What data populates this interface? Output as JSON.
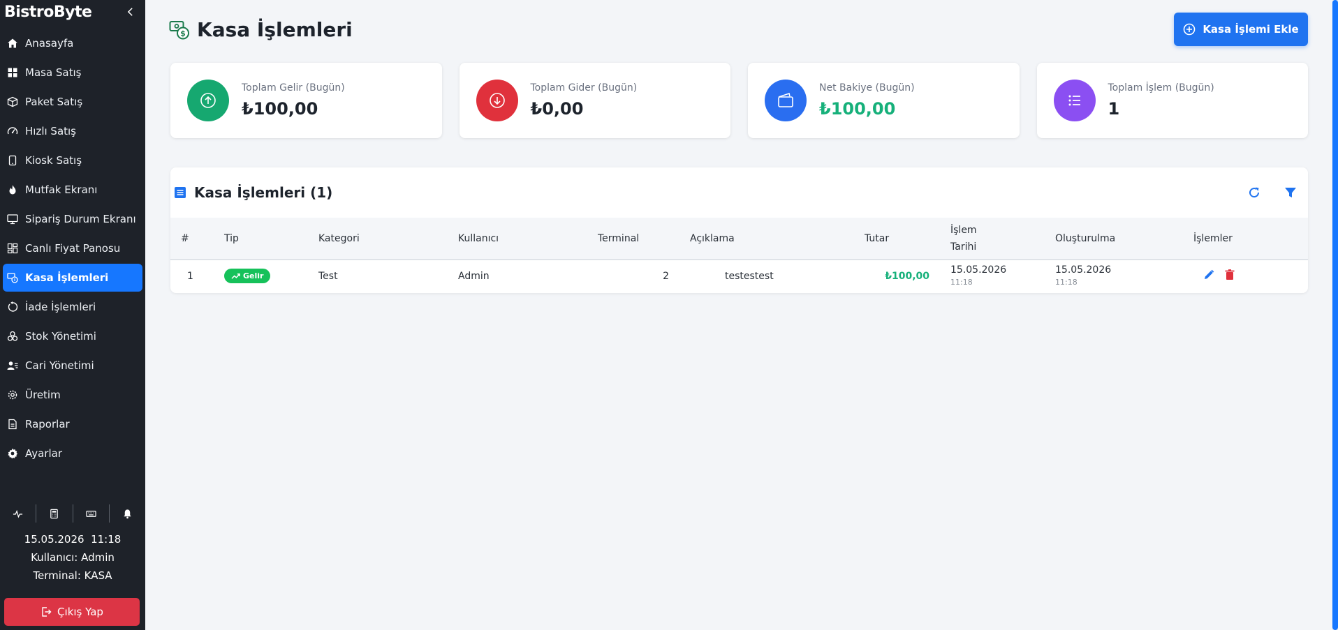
{
  "app": {
    "brand": "BistroByte"
  },
  "sidebar": {
    "items": [
      {
        "label": "Anasayfa",
        "icon": "home-icon"
      },
      {
        "label": "Masa Satış",
        "icon": "grid-icon"
      },
      {
        "label": "Paket Satış",
        "icon": "box-icon"
      },
      {
        "label": "Hızlı Satış",
        "icon": "speedometer-icon"
      },
      {
        "label": "Kiosk Satış",
        "icon": "tablet-icon"
      },
      {
        "label": "Mutfak Ekranı",
        "icon": "fire-icon"
      },
      {
        "label": "Sipariş Durum Ekranı",
        "icon": "monitor-icon"
      },
      {
        "label": "Canlı Fiyat Panosu",
        "icon": "dashboard-icon"
      },
      {
        "label": "Kasa İşlemleri",
        "icon": "cash-icon",
        "active": true
      },
      {
        "label": "İade İşlemleri",
        "icon": "refund-icon"
      },
      {
        "label": "Stok Yönetimi",
        "icon": "boxes-icon"
      },
      {
        "label": "Cari Yönetimi",
        "icon": "user-card-icon"
      },
      {
        "label": "Üretim",
        "icon": "gear-icon"
      },
      {
        "label": "Raporlar",
        "icon": "report-icon"
      },
      {
        "label": "Ayarlar",
        "icon": "settings-icon"
      }
    ],
    "datetime": "15.05.2026  11:18",
    "user": "Kullanıcı: Admin",
    "terminal": "Terminal: KASA",
    "logout_label": "Çıkış Yap"
  },
  "page": {
    "title": "Kasa İşlemleri",
    "add_button": "Kasa İşlemi Ekle"
  },
  "stats": [
    {
      "label": "Toplam Gelir (Bugün)",
      "value": "₺100,00",
      "color": "#16a870"
    },
    {
      "label": "Toplam Gider (Bugün)",
      "value": "₺0,00",
      "color": "#e0313c"
    },
    {
      "label": "Net Bakiye (Bugün)",
      "value": "₺100,00",
      "color": "#2a6ef0"
    },
    {
      "label": "Toplam İşlem (Bugün)",
      "value": "1",
      "color": "#8b4ff2"
    }
  ],
  "table": {
    "title": "Kasa İşlemleri (1)",
    "headers": {
      "num": "#",
      "type": "Tip",
      "category": "Kategori",
      "user": "Kullanıcı",
      "terminal": "Terminal",
      "description": "Açıklama",
      "amount": "Tutar",
      "date_line1": "İşlem",
      "date_line2": "Tarihi",
      "created": "Oluşturulma",
      "actions": "İşlemler"
    },
    "rows": [
      {
        "num": "1",
        "type": "Gelir",
        "category": "Test",
        "user": "Admin",
        "terminal": "2",
        "description": "testestest",
        "amount": "₺100,00",
        "date": "15.05.2026",
        "date_time": "11:18",
        "created": "15.05.2026",
        "created_time": "11:18"
      }
    ]
  },
  "colors": {
    "accent": "#1677ff",
    "income": "#16c15a",
    "danger": "#dc3545"
  }
}
